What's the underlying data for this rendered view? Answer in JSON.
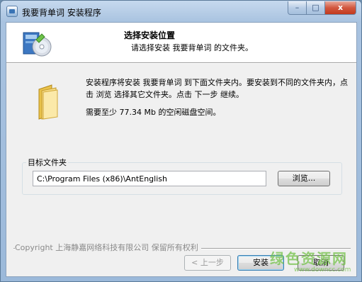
{
  "window": {
    "title": "我要背单词 安装程序",
    "controls": {
      "minimize": "–",
      "maximize": "□",
      "close": "x"
    }
  },
  "header": {
    "title": "选择安装位置",
    "subtitle": "请选择安装 我要背单词 的文件夹。"
  },
  "body": {
    "description": "安装程序将安装 我要背单词 到下面文件夹内。要安装到不同的文件夹内，点击 浏览 选择其它文件夹。点击 下一步 继续。",
    "space_required": "需要至少 77.34 Mb 的空闲磁盘空间。"
  },
  "destination": {
    "group_label": "目标文件夹",
    "path_value": "C:\\Program Files (x86)\\AntEnglish",
    "browse_label": "浏览..."
  },
  "footer": {
    "copyright": "Copyright 上海静嘉网络科技有限公司 保留所有权利",
    "back_label": "< 上一步",
    "install_label": "安装",
    "cancel_label": "取消"
  },
  "watermark": {
    "text": "绿色资源网",
    "url": "www.downcc.com"
  },
  "icons": {
    "app": "installer-app-icon",
    "header": "setup-cd-box-icon",
    "folder": "folder-icon"
  },
  "colors": {
    "titlebar": "#a9c3e0",
    "client_bg": "#f0f0f0",
    "close_button": "#c23a1e",
    "watermark": "#74c24a"
  }
}
